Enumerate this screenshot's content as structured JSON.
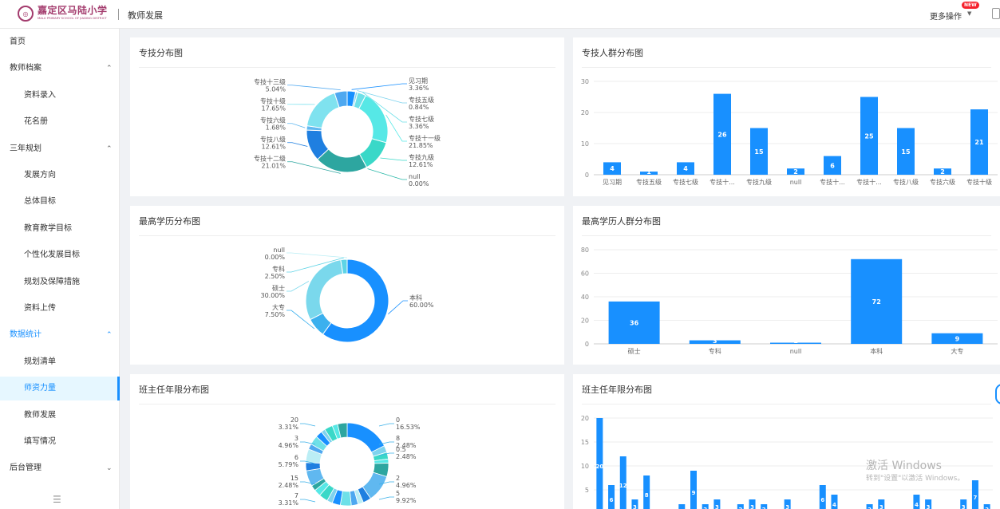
{
  "header": {
    "logo_name": "嘉定区马陆小学",
    "logo_en": "MALU PRIMARY SCHOOL OF JIADING DISTRICT",
    "title": "教师发展",
    "more_label": "更多操作",
    "new_badge": "NEW"
  },
  "sidebar": {
    "items": [
      {
        "label": "首页",
        "level": "top"
      },
      {
        "label": "教师档案",
        "level": "top",
        "chevron": "up"
      },
      {
        "label": "资料录入",
        "level": "sub"
      },
      {
        "label": "花名册",
        "level": "sub"
      },
      {
        "label": "三年规划",
        "level": "top",
        "chevron": "up"
      },
      {
        "label": "发展方向",
        "level": "sub"
      },
      {
        "label": "总体目标",
        "level": "sub"
      },
      {
        "label": "教育教学目标",
        "level": "sub"
      },
      {
        "label": "个性化发展目标",
        "level": "sub"
      },
      {
        "label": "规划及保障措施",
        "level": "sub"
      },
      {
        "label": "资料上传",
        "level": "sub"
      },
      {
        "label": "数据统计",
        "level": "top",
        "chevron": "up",
        "highlight": true
      },
      {
        "label": "规划清单",
        "level": "sub"
      },
      {
        "label": "师资力量",
        "level": "sub",
        "active": true
      },
      {
        "label": "教师发展",
        "level": "sub"
      },
      {
        "label": "填写情况",
        "level": "sub"
      },
      {
        "label": "后台管理",
        "level": "top",
        "chevron": "down"
      }
    ]
  },
  "cards": {
    "c1": "专技分布图",
    "c2": "专技人群分布图",
    "c3": "最高学历分布图",
    "c4": "最高学历人群分布图",
    "c5": "班主任年限分布图",
    "c6": "班主任年限分布图"
  },
  "watermark": {
    "line1": "激活 Windows",
    "line2": "转到\"设置\"以激活 Windows。"
  },
  "colors": {
    "primary": "#1890ff",
    "brand": "#a33b6d"
  },
  "chart_data": [
    {
      "id": "pie1",
      "type": "pie",
      "title": "专技分布图",
      "donut": true,
      "slices": [
        {
          "name": "见习期",
          "value": 3.36,
          "pct": "3.36%",
          "color": "#1890ff"
        },
        {
          "name": "专技五级",
          "value": 0.84,
          "pct": "0.84%",
          "color": "#7fd3ee"
        },
        {
          "name": "专技七级",
          "value": 3.36,
          "pct": "3.36%",
          "color": "#6ee0e8"
        },
        {
          "name": "专技十一级",
          "value": 21.85,
          "pct": "21.85%",
          "color": "#56e8e6"
        },
        {
          "name": "专技九级",
          "value": 12.61,
          "pct": "12.61%",
          "color": "#3ad8c8"
        },
        {
          "name": "null",
          "value": 0.001,
          "pct": "0.00%",
          "color": "#2ab8a8"
        },
        {
          "name": "专技十二级",
          "value": 21.01,
          "pct": "21.01%",
          "color": "#2da6a0"
        },
        {
          "name": "专技八级",
          "value": 12.61,
          "pct": "12.61%",
          "color": "#1f7fe0"
        },
        {
          "name": "专技六级",
          "value": 1.68,
          "pct": "1.68%",
          "color": "#60b8f0"
        },
        {
          "name": "专技十级",
          "value": 17.65,
          "pct": "17.65%",
          "color": "#7fe2ef"
        },
        {
          "name": "专技十三级",
          "value": 5.04,
          "pct": "5.04%",
          "color": "#4ea8f0"
        }
      ]
    },
    {
      "id": "bar1",
      "type": "bar",
      "title": "专技人群分布图",
      "categories": [
        "见习期",
        "专技五级",
        "专技七级",
        "专技十...",
        "专技九级",
        "null",
        "专技十...",
        "专技十...",
        "专技八级",
        "专技六级",
        "专技十级"
      ],
      "values": [
        4,
        1,
        4,
        26,
        15,
        2,
        6,
        25,
        15,
        2,
        21
      ],
      "ylim": [
        0,
        30
      ],
      "yticks": [
        0,
        10,
        20,
        30
      ]
    },
    {
      "id": "pie2",
      "type": "pie",
      "title": "最高学历分布图",
      "donut": true,
      "slices": [
        {
          "name": "本科",
          "value": 60,
          "pct": "60.00%",
          "color": "#1890ff"
        },
        {
          "name": "大专",
          "value": 7.5,
          "pct": "7.50%",
          "color": "#3bb0ee"
        },
        {
          "name": "硕士",
          "value": 30,
          "pct": "30.00%",
          "color": "#7ad8ec"
        },
        {
          "name": "专科",
          "value": 2.5,
          "pct": "2.50%",
          "color": "#5ed4e6"
        },
        {
          "name": "null",
          "value": 0.001,
          "pct": "0.00%",
          "color": "#bbeef5"
        }
      ]
    },
    {
      "id": "bar2",
      "type": "bar",
      "title": "最高学历人群分布图",
      "categories": [
        "硕士",
        "专科",
        "null",
        "本科",
        "大专"
      ],
      "values": [
        36,
        3,
        1,
        72,
        9
      ],
      "ylim": [
        0,
        80
      ],
      "yticks": [
        0,
        20,
        40,
        60,
        80
      ]
    },
    {
      "id": "pie3",
      "type": "pie",
      "title": "班主任年限分布图",
      "donut": true,
      "partial": true,
      "labels": [
        {
          "name": "0",
          "pct": "16.53%"
        },
        {
          "name": "8",
          "pct": "2.48%"
        },
        {
          "name": "0.5",
          "pct": "2.48%"
        },
        {
          "name": "2",
          "pct": "4.96%"
        },
        {
          "name": "5",
          "pct": "9.92%"
        },
        {
          "name": "20",
          "pct": "3.31%"
        },
        {
          "name": "3",
          "pct": "4.96%"
        },
        {
          "name": "6",
          "pct": "5.79%"
        },
        {
          "name": "15",
          "pct": "2.48%"
        },
        {
          "name": "7",
          "pct": "3.31%"
        }
      ]
    },
    {
      "id": "bar3",
      "type": "bar",
      "title": "班主任年限分布图",
      "partial": true,
      "ylim": [
        0,
        20
      ],
      "yticks": [
        0,
        5,
        10,
        15,
        20
      ],
      "values": [
        20,
        6,
        12,
        3,
        8,
        1,
        1,
        2,
        9,
        2,
        3,
        1,
        2,
        3,
        2,
        1,
        3,
        1,
        1,
        6,
        4,
        1,
        1,
        2,
        3,
        1,
        1,
        4,
        3,
        1,
        1,
        3,
        7,
        2
      ],
      "data_labels": [
        "20",
        "6",
        "12",
        "3",
        "8",
        "",
        "",
        "",
        "9",
        "2",
        "3",
        "",
        "2",
        "3",
        "2",
        "",
        "3",
        "",
        "",
        "6",
        "4",
        "",
        "",
        "2",
        "3",
        "",
        "",
        "4",
        "3",
        "",
        "",
        "3",
        "7",
        "2"
      ]
    }
  ]
}
